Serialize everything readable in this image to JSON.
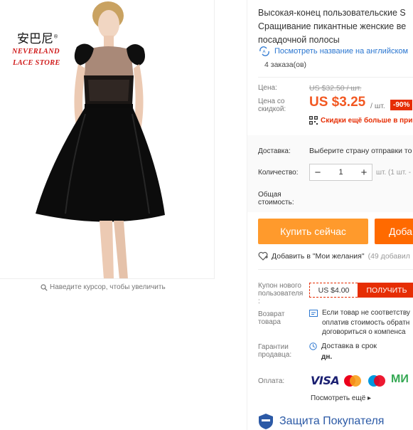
{
  "product_image": {
    "logo_cn": "安巴尼",
    "logo_line1": "NEVERLAND",
    "logo_line2": "LACE STORE",
    "zoom_hint": "Наведите курсор, чтобы увеличить"
  },
  "product": {
    "title_lines": [
      "Высокая-конец пользовательские S",
      "Сращивание пикантные женские ве",
      "посадочной полосы"
    ],
    "translate_link": "Посмотреть название на английском",
    "orders": "4 заказа(ов)"
  },
  "pricing": {
    "price_label": "Цена:",
    "old_price": "US $32.50 / шт.",
    "discount_label_line1": "Цена со",
    "discount_label_line2": "скидкой:",
    "price": "US $3.25",
    "per_unit": "/ шт.",
    "discount_badge": "-90%",
    "app_discount": "Скидки ещё больше в при"
  },
  "purchase": {
    "shipping_label": "Доставка:",
    "shipping_value": "Выберите страну отправки то",
    "quantity_label": "Количество:",
    "quantity_value": "1",
    "minus": "−",
    "plus": "+",
    "stock_info": "шт. (1 шт. -",
    "total_label_line1": "Общая",
    "total_label_line2": "стоимость:"
  },
  "actions": {
    "buy_now": "Купить сейчас",
    "add_to_cart": "Доба",
    "wishlist": "Добавить в \"Мои желания\"",
    "wishlist_count": "(49 добавил"
  },
  "coupon": {
    "label_line1": "Купон нового",
    "label_line2": "пользователя",
    "label_line3": ":",
    "amount": "US $4.00",
    "get_button": "ПОЛУЧИТЬ"
  },
  "returns": {
    "label_line1": "Возврат",
    "label_line2": "товара",
    "text_lines": [
      "Если товар не соответству",
      "оплатив стоимость обратн",
      "договориться о компенса"
    ]
  },
  "guarantee": {
    "label_line1": "Гарантии",
    "label_line2": "продавца:",
    "text": "Доставка в срок",
    "sub": "дн."
  },
  "payment": {
    "label": "Оплата:",
    "visa": "VISA",
    "mir": "МИ",
    "more": "Посмотреть ещё ▸"
  },
  "protection": {
    "title": "Защита Покупателя"
  },
  "colors": {
    "price_orange": "#f25822",
    "buy_button": "#ff9a2c",
    "cart_button": "#ff6a00",
    "badge_red": "#e62e04",
    "link_blue": "#2a76d0"
  }
}
